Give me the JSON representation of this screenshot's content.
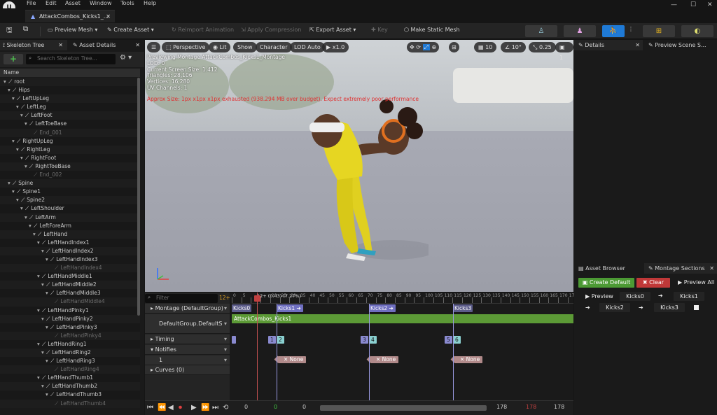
{
  "menu": [
    "File",
    "Edit",
    "Asset",
    "Window",
    "Tools",
    "Help"
  ],
  "window_controls": {
    "minimize": "—",
    "maximize": "☐",
    "close": "✕"
  },
  "doc_tab": {
    "title": "AttackCombos_Kicks1_...",
    "close": "✕"
  },
  "toolbar": {
    "preview_mesh": "Preview Mesh",
    "create_asset": "Create Asset",
    "reimport": "Reimport Animation",
    "apply_compression": "Apply Compression",
    "export_asset": "Export Asset",
    "key": "Key",
    "make_static_mesh": "Make Static Mesh"
  },
  "left": {
    "tab_skeleton": "Skeleton Tree",
    "tab_asset_details": "Asset Details",
    "search_placeholder": "Search Skeleton Tree...",
    "col_name": "Name",
    "bones": [
      {
        "n": "root",
        "d": 0,
        "f": false
      },
      {
        "n": "Hips",
        "d": 1,
        "f": false
      },
      {
        "n": "LeftUpLeg",
        "d": 2,
        "f": false
      },
      {
        "n": "LeftLeg",
        "d": 3,
        "f": false
      },
      {
        "n": "LeftFoot",
        "d": 4,
        "f": false
      },
      {
        "n": "LeftToeBase",
        "d": 5,
        "f": false
      },
      {
        "n": "End_001",
        "d": 6,
        "f": true
      },
      {
        "n": "RightUpLeg",
        "d": 2,
        "f": false
      },
      {
        "n": "RightLeg",
        "d": 3,
        "f": false
      },
      {
        "n": "RightFoot",
        "d": 4,
        "f": false
      },
      {
        "n": "RightToeBase",
        "d": 5,
        "f": false
      },
      {
        "n": "End_002",
        "d": 6,
        "f": true
      },
      {
        "n": "Spine",
        "d": 1,
        "f": false
      },
      {
        "n": "Spine1",
        "d": 2,
        "f": false
      },
      {
        "n": "Spine2",
        "d": 3,
        "f": false
      },
      {
        "n": "LeftShoulder",
        "d": 4,
        "f": false
      },
      {
        "n": "LeftArm",
        "d": 5,
        "f": false
      },
      {
        "n": "LeftForeArm",
        "d": 6,
        "f": false
      },
      {
        "n": "LeftHand",
        "d": 7,
        "f": false
      },
      {
        "n": "LeftHandIndex1",
        "d": 8,
        "f": false
      },
      {
        "n": "LeftHandIndex2",
        "d": 9,
        "f": false
      },
      {
        "n": "LeftHandIndex3",
        "d": 10,
        "f": false
      },
      {
        "n": "LeftHandIndex4",
        "d": 11,
        "f": true
      },
      {
        "n": "LeftHandMiddle1",
        "d": 8,
        "f": false
      },
      {
        "n": "LeftHandMiddle2",
        "d": 9,
        "f": false
      },
      {
        "n": "LeftHandMiddle3",
        "d": 10,
        "f": false
      },
      {
        "n": "LeftHandMiddle4",
        "d": 11,
        "f": true
      },
      {
        "n": "LeftHandPinky1",
        "d": 8,
        "f": false
      },
      {
        "n": "LeftHandPinky2",
        "d": 9,
        "f": false
      },
      {
        "n": "LeftHandPinky3",
        "d": 10,
        "f": false
      },
      {
        "n": "LeftHandPinky4",
        "d": 11,
        "f": true
      },
      {
        "n": "LeftHandRing1",
        "d": 8,
        "f": false
      },
      {
        "n": "LeftHandRing2",
        "d": 9,
        "f": false
      },
      {
        "n": "LeftHandRing3",
        "d": 10,
        "f": false
      },
      {
        "n": "LeftHandRing4",
        "d": 11,
        "f": true
      },
      {
        "n": "LeftHandThumb1",
        "d": 8,
        "f": false
      },
      {
        "n": "LeftHandThumb2",
        "d": 9,
        "f": false
      },
      {
        "n": "LeftHandThumb3",
        "d": 10,
        "f": false
      },
      {
        "n": "LeftHandThumb4",
        "d": 11,
        "f": true
      }
    ]
  },
  "viewport": {
    "perspective": "Perspective",
    "lit": "Lit",
    "show": "Show",
    "character": "Character",
    "lod": "LOD Auto",
    "speed": "x1.0",
    "grid": "10",
    "angle": "10°",
    "scale": "0.25",
    "cams": "1",
    "info": [
      "Previewing Montage AttackCombos_Kicks1_Montage",
      "LOD: 0",
      "Current Screen Size: 1.412",
      "Triangles: 28,106",
      "Vertices: 16,280",
      "UV Channels: 1"
    ],
    "warning": "Approx Size: 1px x1px x1px exhausted (938.294 MB over budget). Expect extremely poor performance"
  },
  "timeline": {
    "filter": "Filter",
    "count": "12+",
    "playhead_label": "12+ (0.43) (7.27%)",
    "rows": {
      "montage": "Montage (DefaultGroup)",
      "slot": "DefaultGroup.DefaultS",
      "timing": "Timing",
      "notifies": "Notifies",
      "notify_track": "1",
      "curves": "Curves (0)"
    },
    "ruler": [
      "0",
      "5",
      "10",
      "15",
      "20",
      "25",
      "30",
      "35",
      "40",
      "45",
      "50",
      "55",
      "60",
      "65",
      "70",
      "75",
      "80",
      "85",
      "90",
      "95",
      "100",
      "105",
      "110",
      "115",
      "120",
      "125",
      "130",
      "135",
      "140",
      "145",
      "150",
      "155",
      "160",
      "165",
      "170",
      "175"
    ],
    "segments": [
      {
        "label": "Kicks0",
        "arrow": false
      },
      {
        "label": "Kicks1",
        "arrow": true
      },
      {
        "label": "Kicks2",
        "arrow": true
      },
      {
        "label": "Kicks3",
        "arrow": false
      }
    ],
    "anim_bar": "AttackCombos_Kicks1",
    "timing_markers": [
      "1",
      "2",
      "3",
      "4",
      "5",
      "6"
    ],
    "notify_tags": [
      "None",
      "None",
      "None"
    ],
    "transport": {
      "start": "0",
      "cur_green": "0",
      "cur": "0",
      "end1": "178",
      "end_red": "178",
      "end2": "178"
    }
  },
  "right": {
    "tab_details": "Details",
    "tab_preview": "Preview Scene S...",
    "tab_asset_browser": "Asset Browser",
    "tab_montage_sections": "Montage Sections",
    "create_default": "Create Default",
    "clear": "Clear",
    "preview_all": "Preview All",
    "preview": "Preview",
    "sections": [
      "Kicks0",
      "Kicks1",
      "Kicks2",
      "Kicks3"
    ]
  },
  "colors": {
    "accent_blue": "#1f7ad6",
    "green": "#5c9a36",
    "red": "#c04040"
  }
}
